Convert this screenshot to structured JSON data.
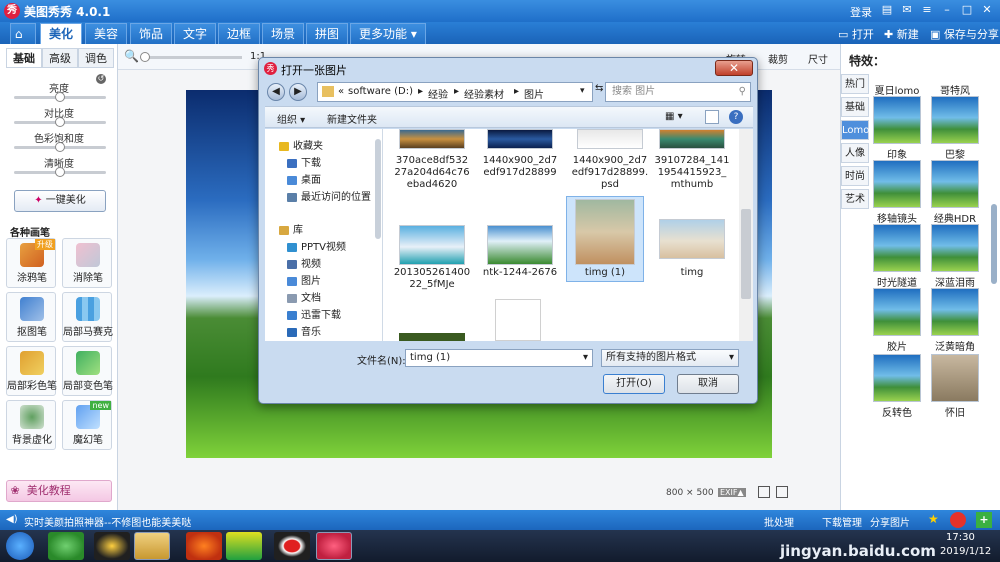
{
  "app": {
    "title": "美图秀秀 4.0.1",
    "login": "登录"
  },
  "menu": {
    "tabs": [
      "美化",
      "美容",
      "饰品",
      "文字",
      "边框",
      "场景",
      "拼图",
      "更多功能"
    ],
    "open": "打开",
    "new": "新建",
    "save": "保存与分享"
  },
  "toolbar": {
    "zoom_label": "1:1",
    "rotate": "旋转",
    "crop": "裁剪",
    "size": "尺寸"
  },
  "left": {
    "tabs": [
      "基础",
      "高级",
      "调色"
    ],
    "sliders": [
      "亮度",
      "对比度",
      "色彩饱和度",
      "清晰度"
    ],
    "auto_button": "一键美化",
    "brush_title": "各种画笔",
    "tools": [
      {
        "label": "涂鸦笔",
        "badge": "升级"
      },
      {
        "label": "消除笔",
        "badge": ""
      },
      {
        "label": "抠图笔",
        "badge": ""
      },
      {
        "label": "局部马赛克",
        "badge": ""
      },
      {
        "label": "局部彩色笔",
        "badge": ""
      },
      {
        "label": "局部变色笔",
        "badge": ""
      },
      {
        "label": "背景虚化",
        "badge": ""
      },
      {
        "label": "魔幻笔",
        "badge": "new"
      }
    ],
    "tutorial": "美化教程"
  },
  "canvas": {
    "dims": "800 × 500",
    "exif": "EXIF▲"
  },
  "right": {
    "title": "特效：",
    "categories": [
      "热门",
      "基础",
      "Lomo",
      "人像",
      "时尚",
      "艺术"
    ],
    "effects": [
      "夏日lomo",
      "哥特风",
      "印象",
      "巴黎",
      "移轴镜头",
      "经典HDR",
      "时光隧道",
      "深蓝泪雨",
      "胶片",
      "泛黄暗角",
      "反转色",
      "怀旧"
    ]
  },
  "status": {
    "tip": "实时美颜拍照神器--不修图也能美美哒",
    "batch": "批处理",
    "download": "下载管理",
    "share": "分享图片"
  },
  "taskbar": {
    "time": "17:30",
    "date": "2019/1/12",
    "watermark": "jingyan.baidu.com"
  },
  "dialog": {
    "title": "打开一张图片",
    "path": [
      "software (D:)",
      "经验",
      "经验素材",
      "图片"
    ],
    "search_placeholder": "搜索 图片",
    "organize": "组织 ▾",
    "new_folder": "新建文件夹",
    "nav": [
      {
        "label": "收藏夹",
        "color": "#e8b820"
      },
      {
        "label": "下载",
        "color": "#3a6fc0"
      },
      {
        "label": "桌面",
        "color": "#4a8ad8"
      },
      {
        "label": "最近访问的位置",
        "color": "#5a7fa8"
      },
      {
        "label": "库",
        "color": "#d8a840"
      },
      {
        "label": "PPTV视频",
        "color": "#3090d0"
      },
      {
        "label": "视频",
        "color": "#4a6fa8"
      },
      {
        "label": "图片",
        "color": "#4a8ad8"
      },
      {
        "label": "文档",
        "color": "#8a9ab0"
      },
      {
        "label": "迅雷下载",
        "color": "#3a7fd0"
      },
      {
        "label": "音乐",
        "color": "#2a6ab8"
      }
    ],
    "files": [
      {
        "name": "370ace8df53227a204d64c76ebad4620",
        "thumb": "linear-gradient(#3a6a90,#c89040,#5a4020)"
      },
      {
        "name": "1440x900_2d7edf917d28899",
        "thumb": "linear-gradient(#0a1a40,#2a5aa0,#0a2050)"
      },
      {
        "name": "1440x900_2d7edf917d28899.psd",
        "thumb": "linear-gradient(#e8e8e8,#ffffff)"
      },
      {
        "name": "39107284_1411954415923_mthumb",
        "thumb": "linear-gradient(#d08030,#3a8a70,#2a5040)"
      },
      {
        "name": "20130526140022_5fMJe",
        "thumb": "linear-gradient(#5ab0e0,#e8f0f8 55%,#20a0b0)"
      },
      {
        "name": "ntk-1244-2676",
        "thumb": "linear-gradient(#4a90d0,#e0f0f8 40%,#3a8a30)"
      },
      {
        "name": "timg (1)",
        "thumb": "linear-gradient(#a0b8a0,#d8c8a8 50%,#c09060)"
      },
      {
        "name": "timg",
        "thumb": "linear-gradient(#b0d0e8,#e8e0d0 55%,#d8c0a0)"
      }
    ],
    "filename_label": "文件名(N):",
    "filename": "timg (1)",
    "filetype": "所有支持的图片格式",
    "open": "打开(O)",
    "cancel": "取消"
  }
}
